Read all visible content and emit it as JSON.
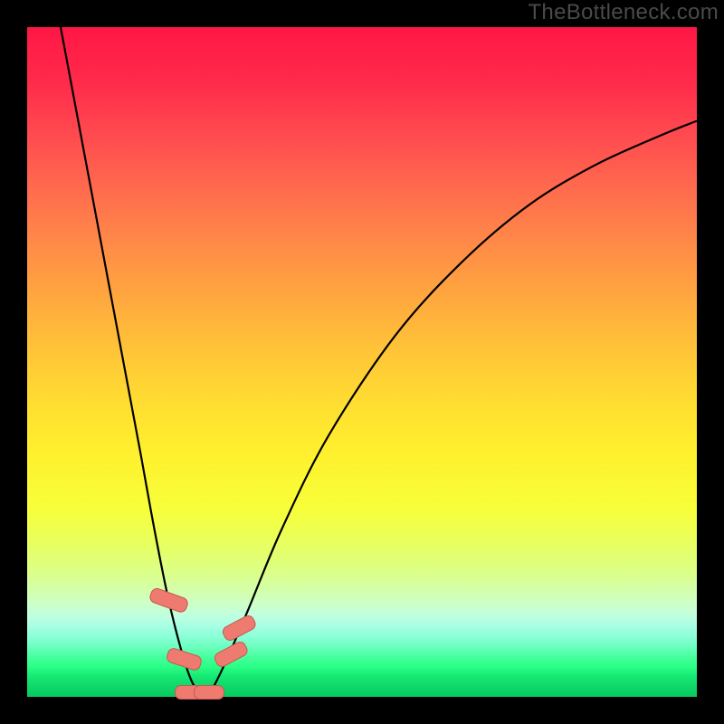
{
  "watermark": "TheBottleneck.com",
  "colors": {
    "background": "#000000",
    "gradient_top": "#ff1745",
    "gradient_mid": "#ffdd31",
    "gradient_bottom": "#06cb5f",
    "curve": "#000000",
    "marker_fill": "#ef7a6f",
    "marker_border": "#c45a52"
  },
  "chart_data": {
    "type": "line",
    "title": "",
    "xlabel": "",
    "ylabel": "",
    "xlim": [
      0,
      100
    ],
    "ylim": [
      0,
      100
    ],
    "grid": false,
    "legend": false,
    "notes": "V-shaped bottleneck curve over vertical red-to-green gradient. Gradient top = worse (red), bottom = better (green). Curve dips to the floor near x≈26 then rises asymptotically.",
    "series": [
      {
        "name": "bottleneck-curve",
        "x": [
          5,
          8,
          11,
          14,
          17,
          19,
          21,
          23,
          24.5,
          26,
          27,
          28,
          30,
          33,
          38,
          45,
          55,
          65,
          75,
          85,
          95,
          100
        ],
        "y": [
          100,
          84,
          68,
          52,
          36,
          25,
          15,
          7,
          2.5,
          0.2,
          0.2,
          1.8,
          6,
          13,
          25,
          39,
          54,
          65,
          73.5,
          79.5,
          84,
          86
        ]
      }
    ],
    "markers": [
      {
        "x": 21.0,
        "y": 14.5,
        "w": 2.0,
        "h": 5.5,
        "rot": -70
      },
      {
        "x": 23.3,
        "y": 5.8,
        "w": 2.0,
        "h": 5.0,
        "rot": -72
      },
      {
        "x": 24.6,
        "y": 0.8,
        "w": 5.2,
        "h": 1.8,
        "rot": 0
      },
      {
        "x": 27.0,
        "y": 0.8,
        "w": 4.3,
        "h": 1.8,
        "rot": 0
      },
      {
        "x": 30.3,
        "y": 6.5,
        "w": 2.0,
        "h": 4.8,
        "rot": 62
      },
      {
        "x": 31.5,
        "y": 10.5,
        "w": 2.0,
        "h": 4.8,
        "rot": 62
      }
    ]
  }
}
